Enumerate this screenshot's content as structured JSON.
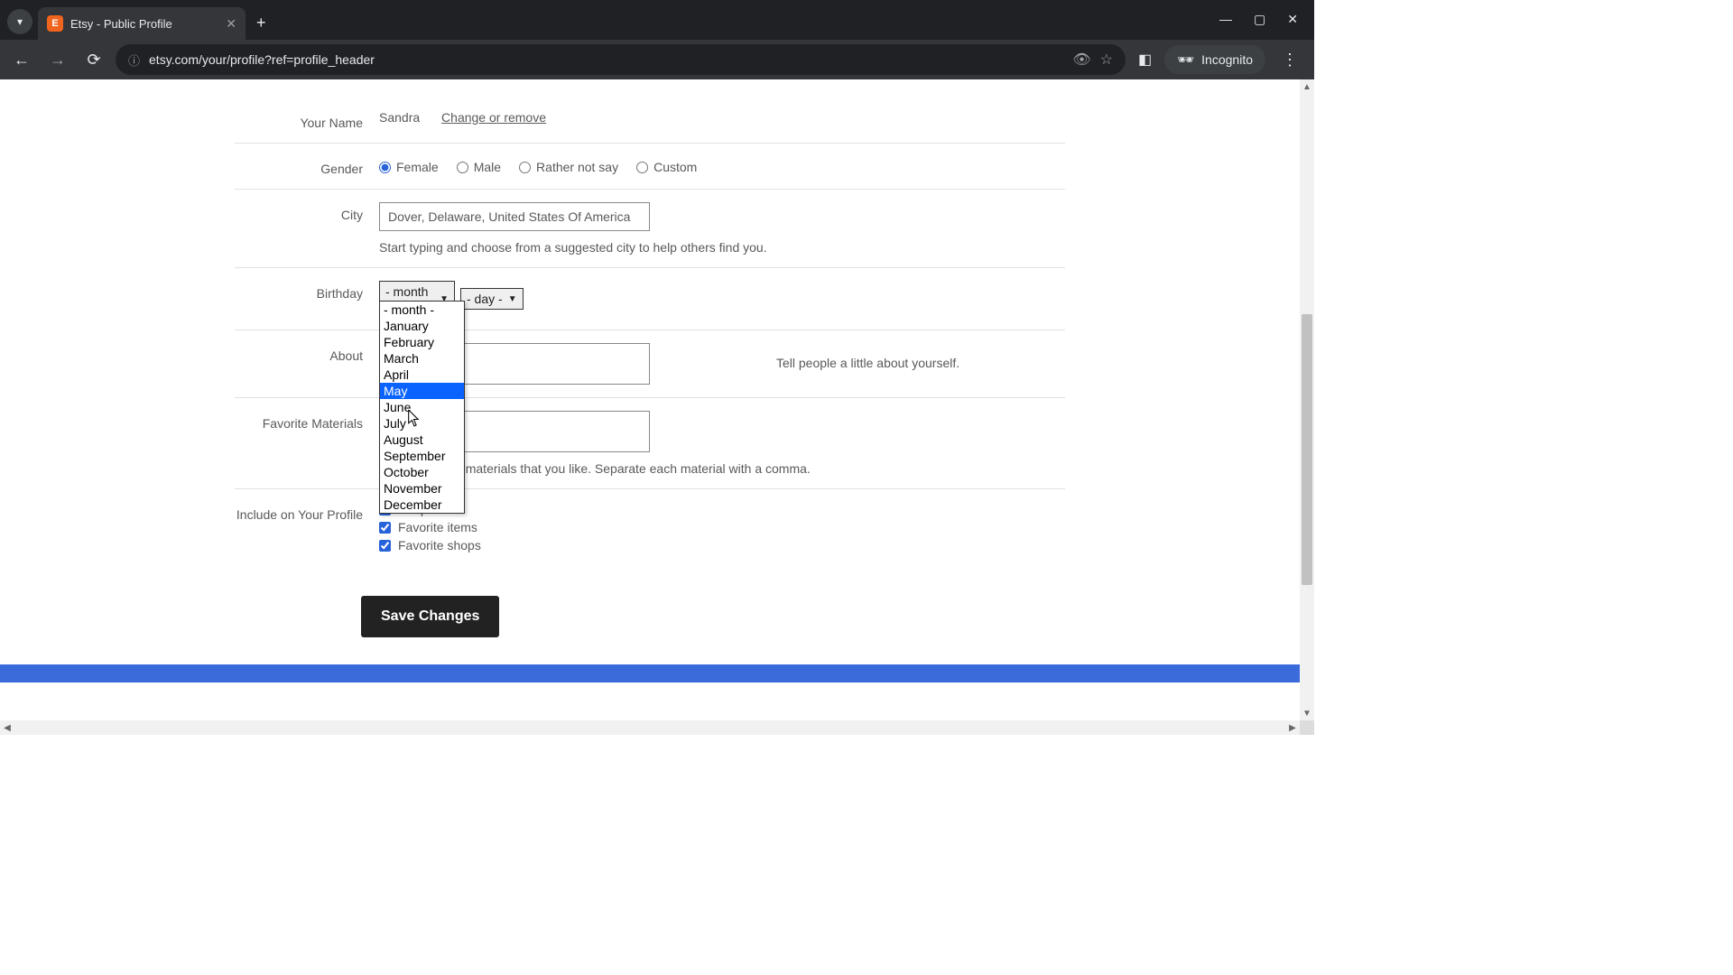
{
  "chrome": {
    "tab_title": "Etsy - Public Profile",
    "favicon_letter": "E",
    "url": "etsy.com/your/profile?ref=profile_header",
    "incognito_label": "Incognito"
  },
  "form": {
    "name": {
      "label": "Your Name",
      "value": "Sandra",
      "change_link": "Change or remove"
    },
    "gender": {
      "label": "Gender",
      "options": [
        "Female",
        "Male",
        "Rather not say",
        "Custom"
      ],
      "selected": "Female"
    },
    "city": {
      "label": "City",
      "value": "Dover, Delaware, United States Of America",
      "hint": "Start typing and choose from a suggested city to help others find you."
    },
    "birthday": {
      "label": "Birthday",
      "month_display": "- month -",
      "day_display": "- day -",
      "month_options": [
        "- month -",
        "January",
        "February",
        "March",
        "April",
        "May",
        "June",
        "July",
        "August",
        "September",
        "October",
        "November",
        "December"
      ],
      "highlighted": "May"
    },
    "about": {
      "label": "About",
      "hint": "Tell people a little about yourself."
    },
    "materials": {
      "label": "Favorite Materials",
      "hint": "Share up to 13 materials that you like. Separate each material with a comma."
    },
    "include": {
      "label": "Include on Your Profile",
      "items": [
        "Shop",
        "Favorite items",
        "Favorite shops"
      ]
    },
    "save_label": "Save Changes"
  }
}
